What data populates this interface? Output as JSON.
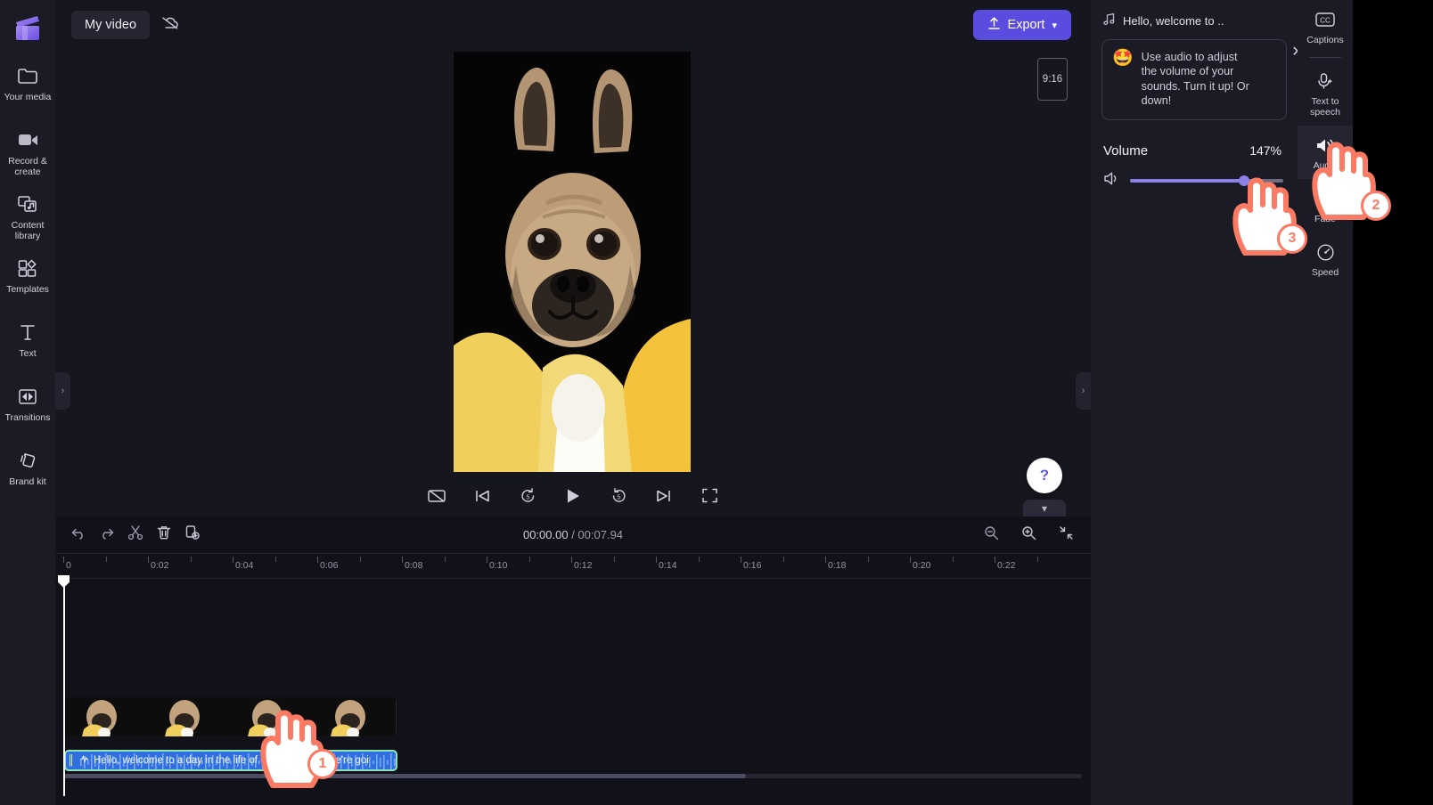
{
  "app": {
    "name": "Clipchamp Video Editor",
    "accent": "#5b4ce0"
  },
  "left_rail": {
    "logo_name": "clipchamp-logo",
    "items": [
      {
        "label": "Your media",
        "icon": "folder-icon"
      },
      {
        "label": "Record & create",
        "icon": "video-camera-icon"
      },
      {
        "label": "Content library",
        "icon": "content-library-icon"
      },
      {
        "label": "Templates",
        "icon": "templates-icon"
      },
      {
        "label": "Text",
        "icon": "text-icon"
      },
      {
        "label": "Transitions",
        "icon": "transitions-icon"
      },
      {
        "label": "Brand kit",
        "icon": "brand-kit-icon"
      }
    ],
    "collapse_icon": "chevron-right-icon"
  },
  "topbar": {
    "project_name": "My video",
    "cloud_icon": "cloud-off-icon",
    "export_label": "Export",
    "export_icon": "upload-icon",
    "export_chevron": "chevron-down-icon"
  },
  "preview": {
    "ratio_badge": "9:16",
    "help_icon": "?",
    "collapse_chevron": "chevron-down-icon",
    "controls": [
      {
        "name": "split-screen-off-button",
        "icon": "rectangle-slash-icon"
      },
      {
        "name": "skip-previous-button",
        "icon": "skip-back-icon"
      },
      {
        "name": "rewind-5-button",
        "icon": "rewind-5-icon"
      },
      {
        "name": "play-button",
        "icon": "play-icon"
      },
      {
        "name": "forward-5-button",
        "icon": "forward-5-icon"
      },
      {
        "name": "skip-next-button",
        "icon": "skip-forward-icon"
      },
      {
        "name": "fullscreen-button",
        "icon": "fullscreen-icon"
      }
    ]
  },
  "properties": {
    "header_title": "Hello, welcome to ..",
    "header_icon": "music-note-icon",
    "tip": {
      "emoji": "🤩",
      "text": "Use audio to adjust the volume of your sounds. Turn it up! Or down!",
      "close_icon": "close-icon"
    },
    "volume": {
      "label": "Volume",
      "value": "147%",
      "percent": 81,
      "speaker_icon": "speaker-icon"
    }
  },
  "tool_rail": {
    "items": [
      {
        "label": "Captions",
        "icon": "cc-icon",
        "active": false
      },
      {
        "label": "Text to speech",
        "icon": "microphone-sparkle-icon",
        "active": false
      },
      {
        "label": "Audio",
        "icon": "speaker-wave-icon",
        "active": true
      },
      {
        "label": "Fade",
        "icon": "fade-icon",
        "active": false
      },
      {
        "label": "Speed",
        "icon": "speedometer-icon",
        "active": false
      }
    ]
  },
  "timeline": {
    "tools": [
      {
        "name": "undo-button",
        "icon": "undo-icon"
      },
      {
        "name": "redo-button",
        "icon": "redo-icon"
      },
      {
        "name": "split-button",
        "icon": "scissors-icon"
      },
      {
        "name": "delete-button",
        "icon": "trash-icon"
      },
      {
        "name": "duplicate-button",
        "icon": "duplicate-icon"
      }
    ],
    "current_time": "00:00.00",
    "separator": " / ",
    "total_time": "00:07.94",
    "zoom_tools": [
      {
        "name": "zoom-out-button",
        "icon": "magnifier-minus-icon"
      },
      {
        "name": "zoom-in-button",
        "icon": "magnifier-plus-icon"
      },
      {
        "name": "fit-timeline-button",
        "icon": "fit-icon"
      }
    ],
    "ruler_labels": [
      "0",
      "0:02",
      "0:04",
      "0:06",
      "0:08",
      "0:10",
      "0:12",
      "0:14",
      "0:16",
      "0:18",
      "0:20",
      "0:22"
    ],
    "audio_clip": {
      "label": "Hello, welcome to a day in the life of Cookie. Today we're goi",
      "icon": "audio-wave-icon"
    },
    "video_track_name": "video-clip"
  },
  "annotations": {
    "steps": [
      {
        "number": "1",
        "target": "audio-clip-in-timeline"
      },
      {
        "number": "2",
        "target": "audio-tool-rail-item"
      },
      {
        "number": "3",
        "target": "volume-slider-knob"
      }
    ]
  }
}
